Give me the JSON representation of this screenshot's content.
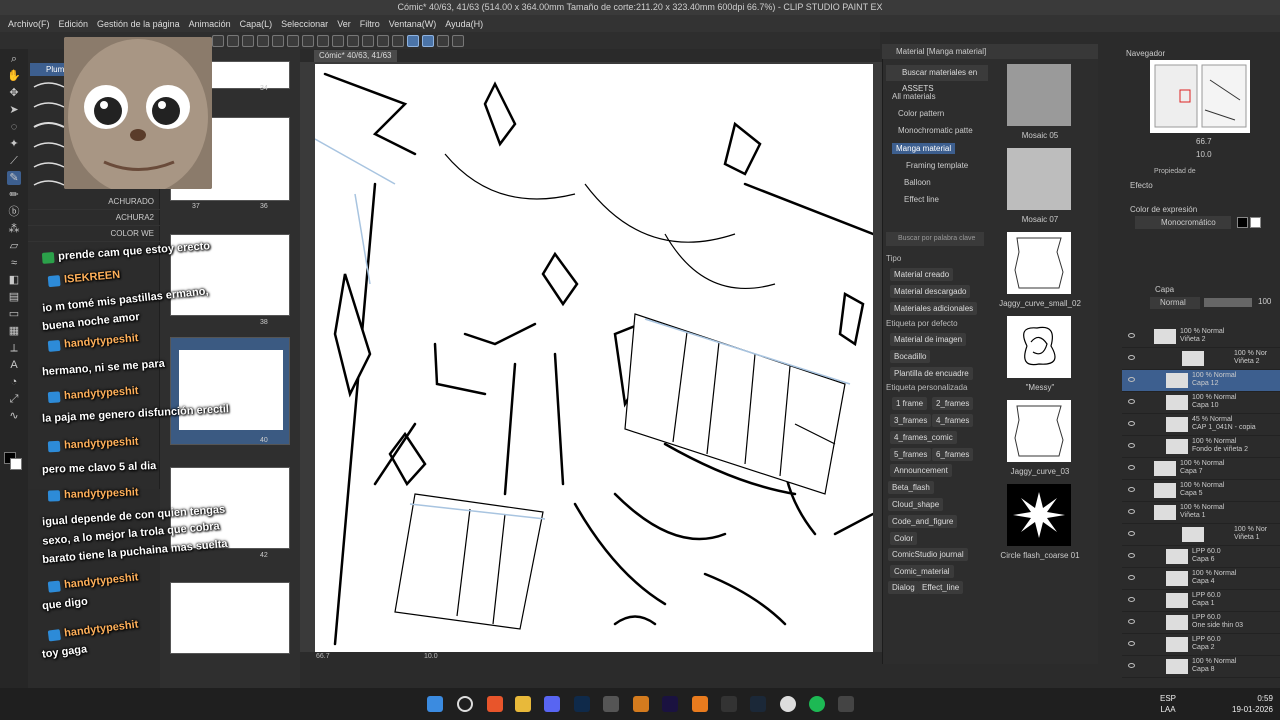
{
  "window": {
    "title": "Cómic* 40/63, 41/63 (514.00 x 364.00mm Tamaño de corte:211.20 x 323.40mm 600dpi 66.7%) - CLIP STUDIO PAINT EX"
  },
  "menu": [
    "Archivo(F)",
    "Edición",
    "Gestión de la página",
    "Animación",
    "Capa(L)",
    "Seleccionar",
    "Ver",
    "Filtro",
    "Ventana(W)",
    "Ayuda(H)"
  ],
  "canvas_tab": "Cómic* 40/63, 41/63",
  "canvas_status": {
    "zoom": "66.7",
    "rotation": "10.0"
  },
  "brush_panel": {
    "tab": "Plumil",
    "items": [
      "ACHURADO",
      "ACHURA2",
      "COLOR WE"
    ]
  },
  "pages": {
    "numbers": [
      "34",
      "37",
      "36",
      "38",
      "40",
      "42"
    ]
  },
  "chat": [
    {
      "name": "",
      "text": "prende cam que estoy erecto",
      "badge": "green"
    },
    {
      "name": "ISEKREEN",
      "text": "",
      "badge": "blue"
    },
    {
      "name": "",
      "text": "io   m tomé mis pastillas ermano,"
    },
    {
      "name": "",
      "text": "buena noche amor"
    },
    {
      "name": "handytypeshit",
      "text": "",
      "badge": "blue"
    },
    {
      "name": "",
      "text": "hermano, ni se me para"
    },
    {
      "name": "handytypeshit",
      "text": "",
      "badge": "blue"
    },
    {
      "name": "",
      "text": "la paja me genero disfunción erectil"
    },
    {
      "name": "handytypeshit",
      "text": "",
      "badge": "blue"
    },
    {
      "name": "",
      "text": "pero     me clavo 5 al dia"
    },
    {
      "name": "handytypeshit",
      "text": "",
      "badge": "blue"
    },
    {
      "name": "",
      "text": "igual depende de con quien tengas"
    },
    {
      "name": "",
      "text": "sexo, a lo mejor la trola que cobra"
    },
    {
      "name": "",
      "text": "barato tiene la puchaina mas suelta"
    },
    {
      "name": "handytypeshit",
      "text": "",
      "badge": "blue"
    },
    {
      "name": "",
      "text": "que digo"
    },
    {
      "name": "handytypeshit",
      "text": "",
      "badge": "blue"
    },
    {
      "name": "",
      "text": "toy gaga"
    }
  ],
  "material_panel": {
    "header": "Material [Manga material]",
    "search_button": "Buscar materiales en ASSETS",
    "tree": [
      "All materials",
      "Color pattern",
      "Monochromatic patte",
      "Manga material",
      "Framing template",
      "Balloon",
      "Effect line"
    ],
    "keyword_placeholder": "Buscar por palabra clave",
    "tipo_label": "Tipo",
    "tipo_tags": [
      "Material creado",
      "Material descargado",
      "Materiales adicionales"
    ],
    "default_label": "Etiqueta por defecto",
    "default_tags": [
      "Material de imagen",
      "Bocadillo",
      "Plantilla de encuadre"
    ],
    "custom_label": "Etiqueta personalizada",
    "custom_tags": [
      "1 frame",
      "2_frames",
      "3_frames",
      "4_frames",
      "4_frames_comic",
      "5_frames",
      "6_frames",
      "Announcement",
      "Beta_flash",
      "Cloud_shape",
      "Code_and_figure",
      "Color",
      "ComicStudio journal",
      "Comic_material",
      "Dialog",
      "Effect_line"
    ],
    "thumbs": [
      "Mosaic 05",
      "Mosaic 07",
      "Jaggy_curve_small_02",
      "\"Messy\"",
      "Jaggy_curve_03",
      "Circle flash_coarse 01"
    ]
  },
  "navigator": {
    "title": "Navegador",
    "zoom": "66.7",
    "rotation": "10.0"
  },
  "properties": {
    "title": "Propiedad de",
    "effect_label": "Efecto",
    "expression_label": "Color de expresión",
    "expression_value": "Monocromático"
  },
  "layers": {
    "title": "Capa",
    "blend": "Normal",
    "opacity": "100",
    "rows": [
      {
        "mode": "100 % Normal",
        "name": "Viñeta 2"
      },
      {
        "mode": "100 % Nor",
        "name": "Viñeta 2"
      },
      {
        "mode": "100 % Normal",
        "name": "Capa 12"
      },
      {
        "mode": "100 % Normal",
        "name": "Capa 10"
      },
      {
        "mode": "45 % Normal",
        "name": "CAP 1_041N - copia"
      },
      {
        "mode": "100 % Normal",
        "name": "Fondo de viñeta 2"
      },
      {
        "mode": "100 % Normal",
        "name": "Capa 7"
      },
      {
        "mode": "100 % Normal",
        "name": "Capa 5"
      },
      {
        "mode": "100 % Normal",
        "name": "Viñeta 1"
      },
      {
        "mode": "100 % Nor",
        "name": "Viñeta 1"
      },
      {
        "mode": "LPP 60.0",
        "name": "Capa 6"
      },
      {
        "mode": "100 % Normal",
        "name": "Capa 4"
      },
      {
        "mode": "LPP 60.0",
        "name": "Capa 1"
      },
      {
        "mode": "LPP 60.0",
        "name": "One side thin 03"
      },
      {
        "mode": "LPP 60.0",
        "name": "Capa 2"
      },
      {
        "mode": "100 % Normal",
        "name": "Capa 8"
      }
    ]
  },
  "taskbar": {
    "lang": "ESP",
    "lang2": "LAA",
    "time": "0:59",
    "date": "19-01-2026"
  }
}
